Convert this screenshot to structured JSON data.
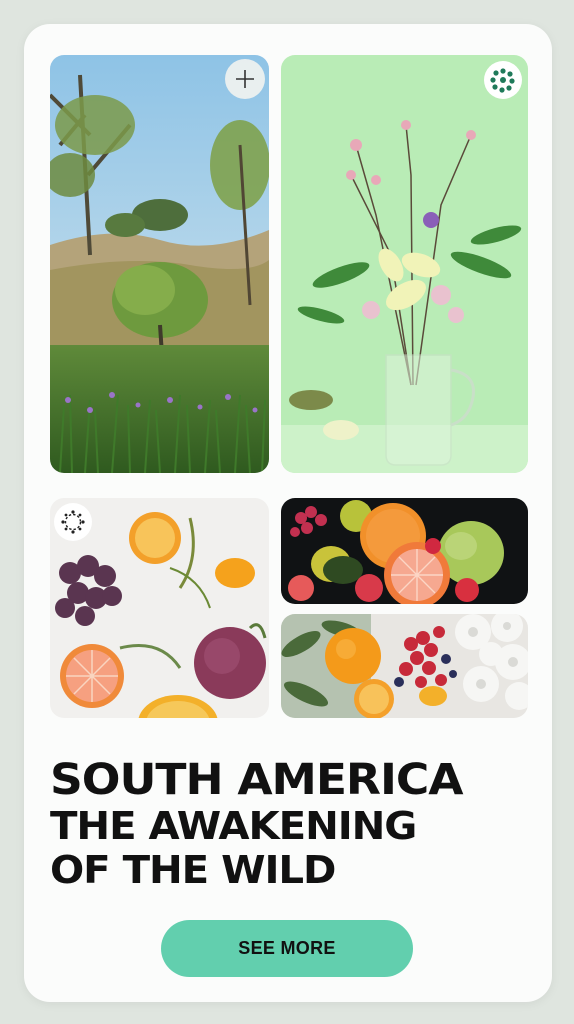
{
  "gallery": {
    "items": [
      {
        "name": "savanna-landscape",
        "action_icon": "plus-icon"
      },
      {
        "name": "flower-vase",
        "action_icon": "dots-circle-icon"
      },
      {
        "name": "fruit-flatlay",
        "action_icon": "ring-icon"
      },
      {
        "name": "fruit-dark"
      },
      {
        "name": "fruit-flowers"
      }
    ]
  },
  "headline": {
    "line1": "SOUTH AMERICA",
    "line2": "THE AWAKENING",
    "line3": "OF THE WILD"
  },
  "cta": {
    "label": "SEE MORE"
  },
  "colors": {
    "background": "#dfe5df",
    "card": "#fbfcfb",
    "accent": "#62cfae",
    "text": "#111111"
  }
}
